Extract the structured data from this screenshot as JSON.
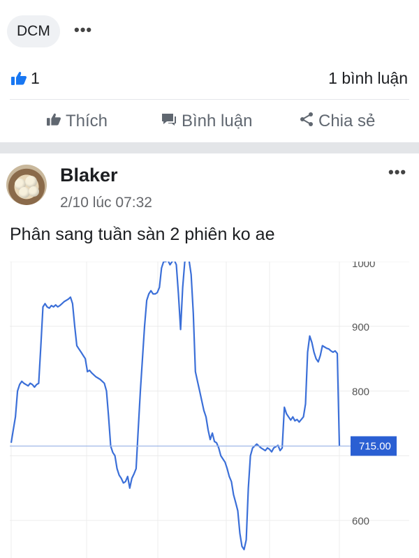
{
  "top_comment": {
    "author": "DCM",
    "more": "•••"
  },
  "stats": {
    "like_count": "1",
    "comment_count": "1 bình luận"
  },
  "actions": {
    "like": "Thích",
    "comment": "Bình luận",
    "share": "Chia sẻ"
  },
  "post": {
    "author": "Blaker",
    "timestamp": "2/10 lúc 07:32",
    "more": "•••",
    "text": "Phân sang tuần sàn 2 phiên ko ae"
  },
  "colors": {
    "line": "#3b6fd8",
    "badge": "#2a5fd3",
    "like_blue": "#1877f2"
  },
  "chart_data": {
    "type": "line",
    "title": "",
    "xlabel": "",
    "ylabel": "",
    "ylim": [
      542,
      1000
    ],
    "y_ticks": [
      "1000",
      "900",
      "800",
      "600"
    ],
    "current_value": 715,
    "current_label": "715.00",
    "grid": true,
    "series": [
      {
        "values": [
          720,
          740,
          760,
          800,
          810,
          815,
          812,
          810,
          808,
          812,
          810,
          806,
          810,
          812,
          870,
          930,
          935,
          930,
          928,
          932,
          930,
          933,
          930,
          932,
          935,
          938,
          940,
          942,
          945,
          935,
          900,
          870,
          865,
          860,
          855,
          850,
          830,
          832,
          828,
          825,
          822,
          820,
          818,
          815,
          812,
          800,
          760,
          715,
          705,
          700,
          680,
          670,
          665,
          658,
          660,
          668,
          650,
          665,
          672,
          680,
          740,
          800,
          850,
          900,
          940,
          950,
          955,
          950,
          950,
          952,
          960,
          990,
          1000,
          1000,
          1005,
          995,
          1000,
          1010,
          995,
          950,
          895,
          960,
          1000,
          1010,
          1020,
          980,
          920,
          830,
          815,
          800,
          785,
          770,
          760,
          740,
          725,
          735,
          722,
          720,
          712,
          700,
          695,
          690,
          680,
          668,
          660,
          640,
          628,
          615,
          580,
          560,
          555,
          570,
          650,
          700,
          712,
          715,
          718,
          715,
          712,
          710,
          708,
          712,
          710,
          706,
          712,
          714,
          716,
          708,
          712,
          775,
          765,
          760,
          755,
          760,
          754,
          756,
          752,
          756,
          760,
          780,
          860,
          885,
          875,
          860,
          850,
          845,
          855,
          870,
          868,
          866,
          865,
          862,
          860,
          862,
          858,
          715
        ]
      }
    ]
  }
}
